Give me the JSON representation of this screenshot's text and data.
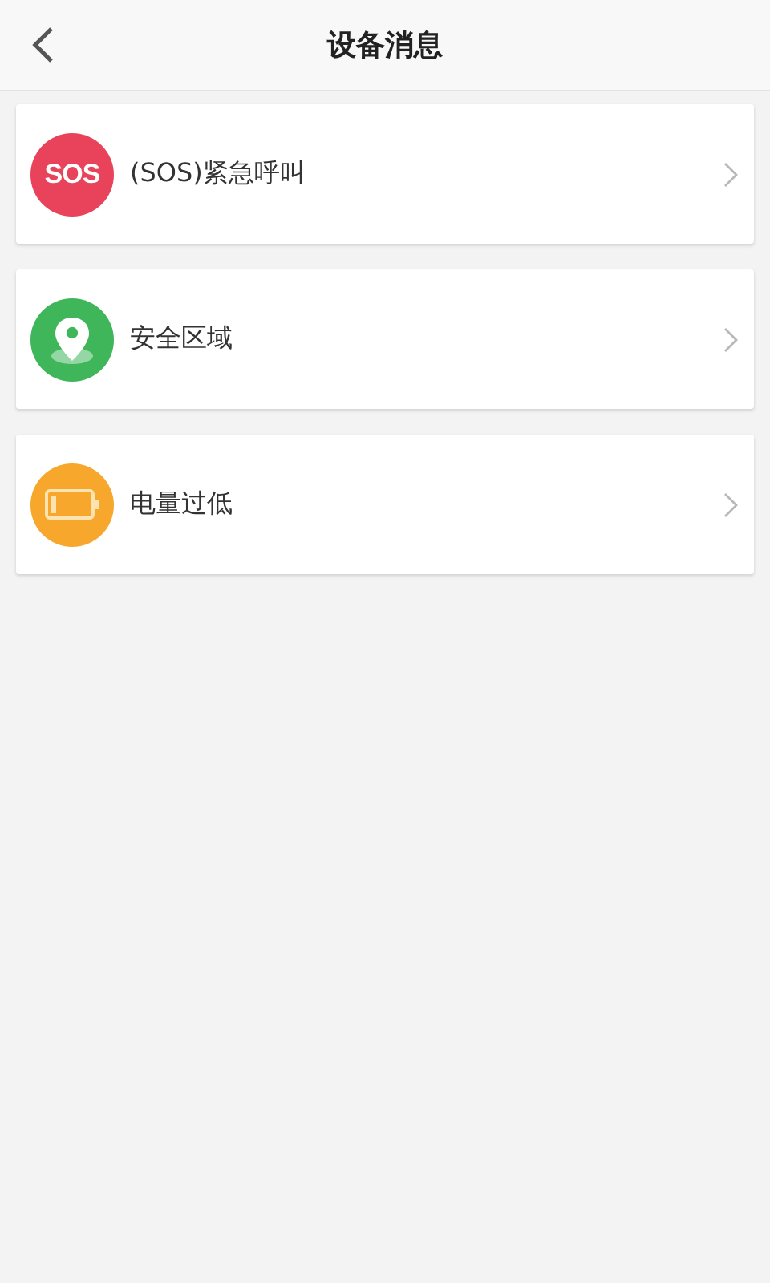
{
  "header": {
    "title": "设备消息"
  },
  "items": [
    {
      "kind": "sos",
      "icon_text": "SOS",
      "color": "#e8435a",
      "label": "(SOS)紧急呼叫"
    },
    {
      "kind": "location",
      "color": "#3fb65a",
      "label": "安全区域"
    },
    {
      "kind": "battery",
      "color": "#f7a82c",
      "label": "电量过低"
    }
  ]
}
